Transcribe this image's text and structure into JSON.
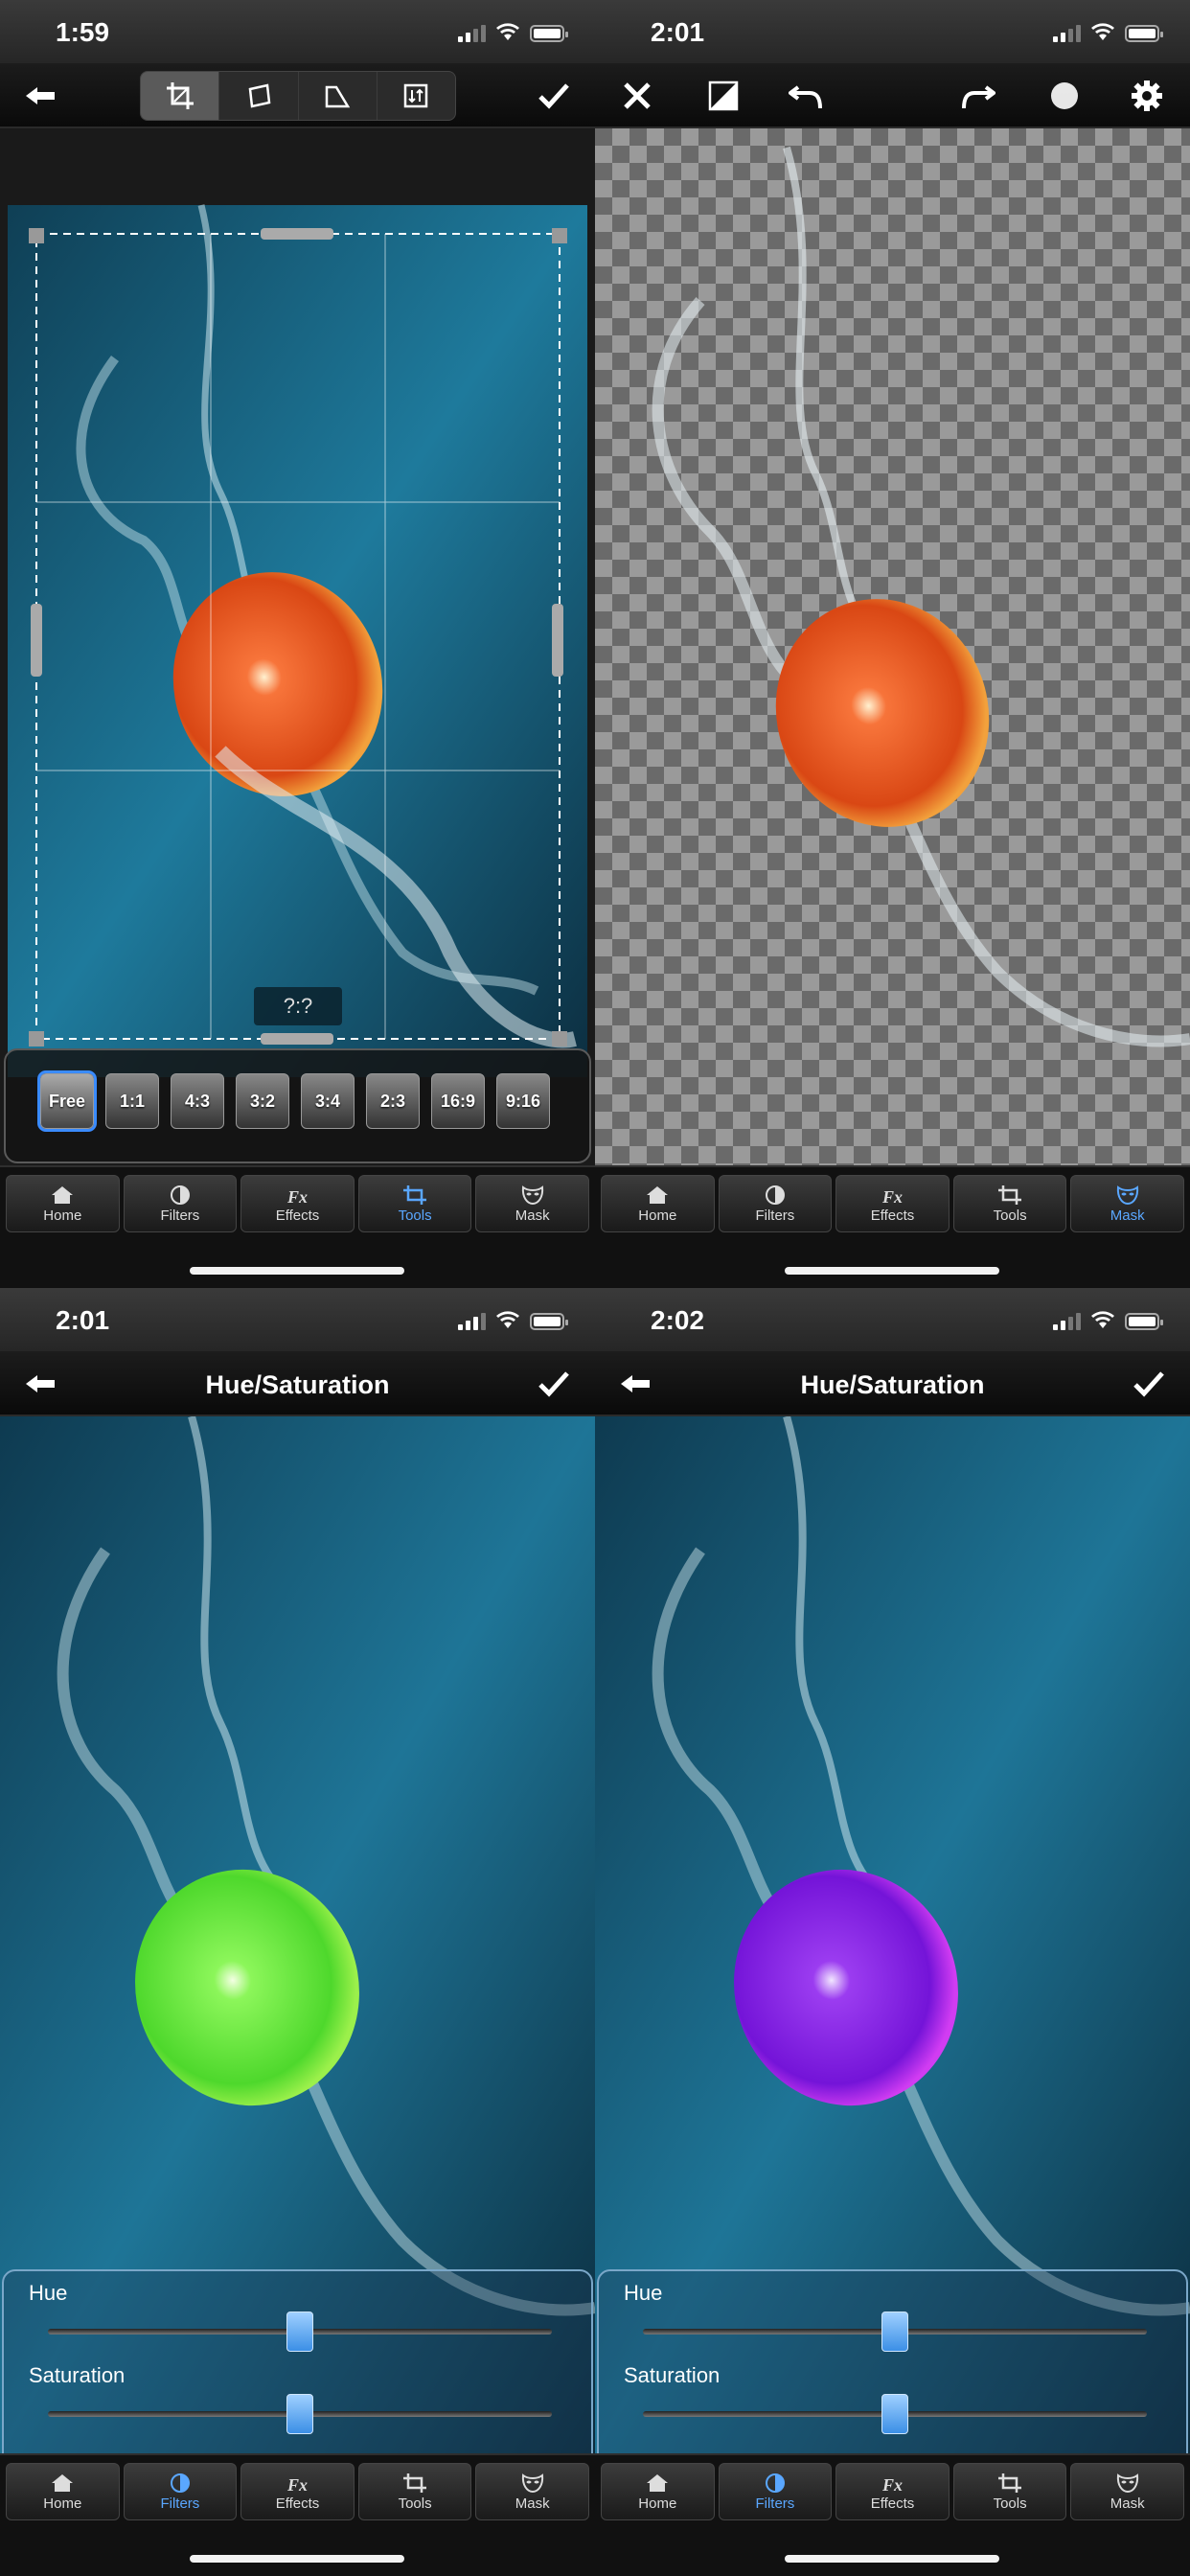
{
  "screens": [
    {
      "time": "1:59"
    },
    {
      "time": "2:01"
    },
    {
      "time": "2:01",
      "title": "Hue/Saturation"
    },
    {
      "time": "2:02",
      "title": "Hue/Saturation"
    }
  ],
  "crop": {
    "ratio_readout": "?:?",
    "ratios": [
      "Free",
      "1:1",
      "4:3",
      "3:2",
      "3:4",
      "2:3",
      "16:9",
      "9:16"
    ],
    "selected_ratio": "Free"
  },
  "hue_saturation": {
    "hue_label": "Hue",
    "saturation_label": "Saturation",
    "screen3": {
      "hue": 0.5,
      "saturation": 0.5,
      "fruit_color": "#5cf03a"
    },
    "screen4": {
      "hue": 0.5,
      "saturation": 0.5,
      "fruit_color": "#8a1fe8"
    }
  },
  "tabs": [
    {
      "label": "Home",
      "icon": "home-icon"
    },
    {
      "label": "Filters",
      "icon": "filters-icon"
    },
    {
      "label": "Effects",
      "icon": "effects-icon"
    },
    {
      "label": "Tools",
      "icon": "tools-icon"
    },
    {
      "label": "Mask",
      "icon": "mask-icon"
    }
  ],
  "active_tabs": [
    "Tools",
    "Mask",
    "Filters",
    "Filters"
  ],
  "colors": {
    "accent": "#3a8bff",
    "water": "#1d6f8f",
    "orange": "#ea5a1c"
  }
}
